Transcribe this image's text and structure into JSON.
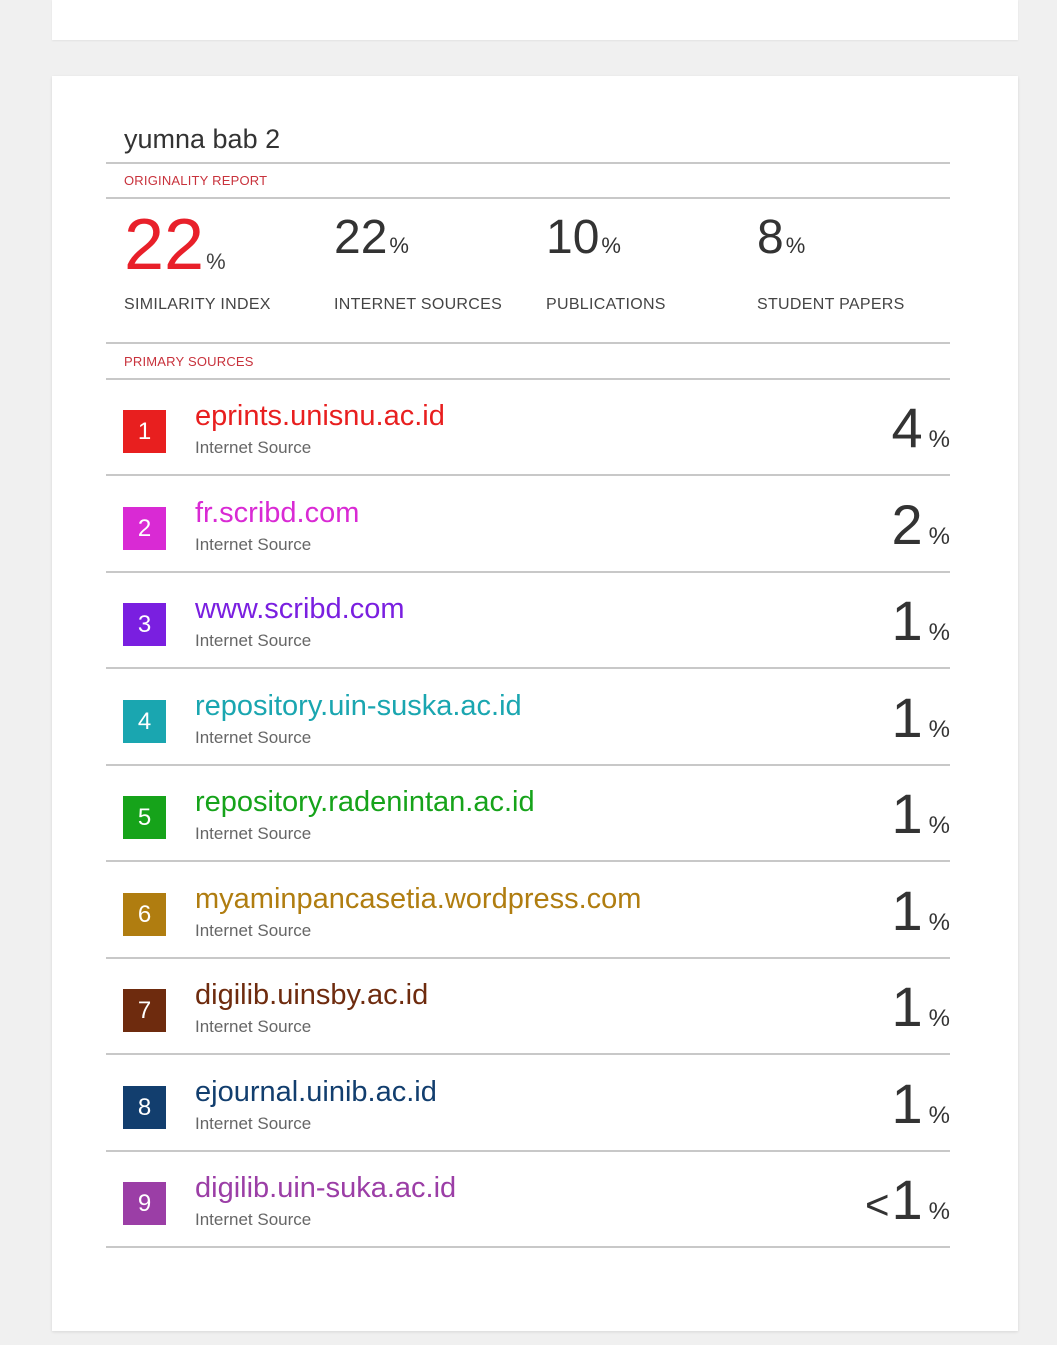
{
  "report": {
    "title": "yumna bab 2",
    "originality_label": "ORIGINALITY REPORT",
    "primary_sources_label": "PRIMARY SOURCES"
  },
  "metrics": [
    {
      "value": "22",
      "unit": "%",
      "label": "SIMILARITY INDEX"
    },
    {
      "value": "22",
      "unit": "%",
      "label": "INTERNET SOURCES"
    },
    {
      "value": "10",
      "unit": "%",
      "label": "PUBLICATIONS"
    },
    {
      "value": "8",
      "unit": "%",
      "label": "STUDENT PAPERS"
    }
  ],
  "sources": [
    {
      "rank": "1",
      "name": "eprints.unisnu.ac.id",
      "type": "Internet Source",
      "prefix": "",
      "percent": "4",
      "unit": "%",
      "color": "#e81f1f"
    },
    {
      "rank": "2",
      "name": "fr.scribd.com",
      "type": "Internet Source",
      "prefix": "",
      "percent": "2",
      "unit": "%",
      "color": "#d92ad4"
    },
    {
      "rank": "3",
      "name": "www.scribd.com",
      "type": "Internet Source",
      "prefix": "",
      "percent": "1",
      "unit": "%",
      "color": "#7a1fe0"
    },
    {
      "rank": "4",
      "name": "repository.uin-suska.ac.id",
      "type": "Internet Source",
      "prefix": "",
      "percent": "1",
      "unit": "%",
      "color": "#1aa6b0"
    },
    {
      "rank": "5",
      "name": "repository.radenintan.ac.id",
      "type": "Internet Source",
      "prefix": "",
      "percent": "1",
      "unit": "%",
      "color": "#16a31a"
    },
    {
      "rank": "6",
      "name": "myaminpancasetia.wordpress.com",
      "type": "Internet Source",
      "prefix": "",
      "percent": "1",
      "unit": "%",
      "color": "#b07d10"
    },
    {
      "rank": "7",
      "name": "digilib.uinsby.ac.id",
      "type": "Internet Source",
      "prefix": "",
      "percent": "1",
      "unit": "%",
      "color": "#6e2b0e"
    },
    {
      "rank": "8",
      "name": "ejournal.uinib.ac.id",
      "type": "Internet Source",
      "prefix": "",
      "percent": "1",
      "unit": "%",
      "color": "#123e6e"
    },
    {
      "rank": "9",
      "name": "digilib.uin-suka.ac.id",
      "type": "Internet Source",
      "prefix": "<",
      "percent": "1",
      "unit": "%",
      "color": "#9b3ea6"
    }
  ]
}
